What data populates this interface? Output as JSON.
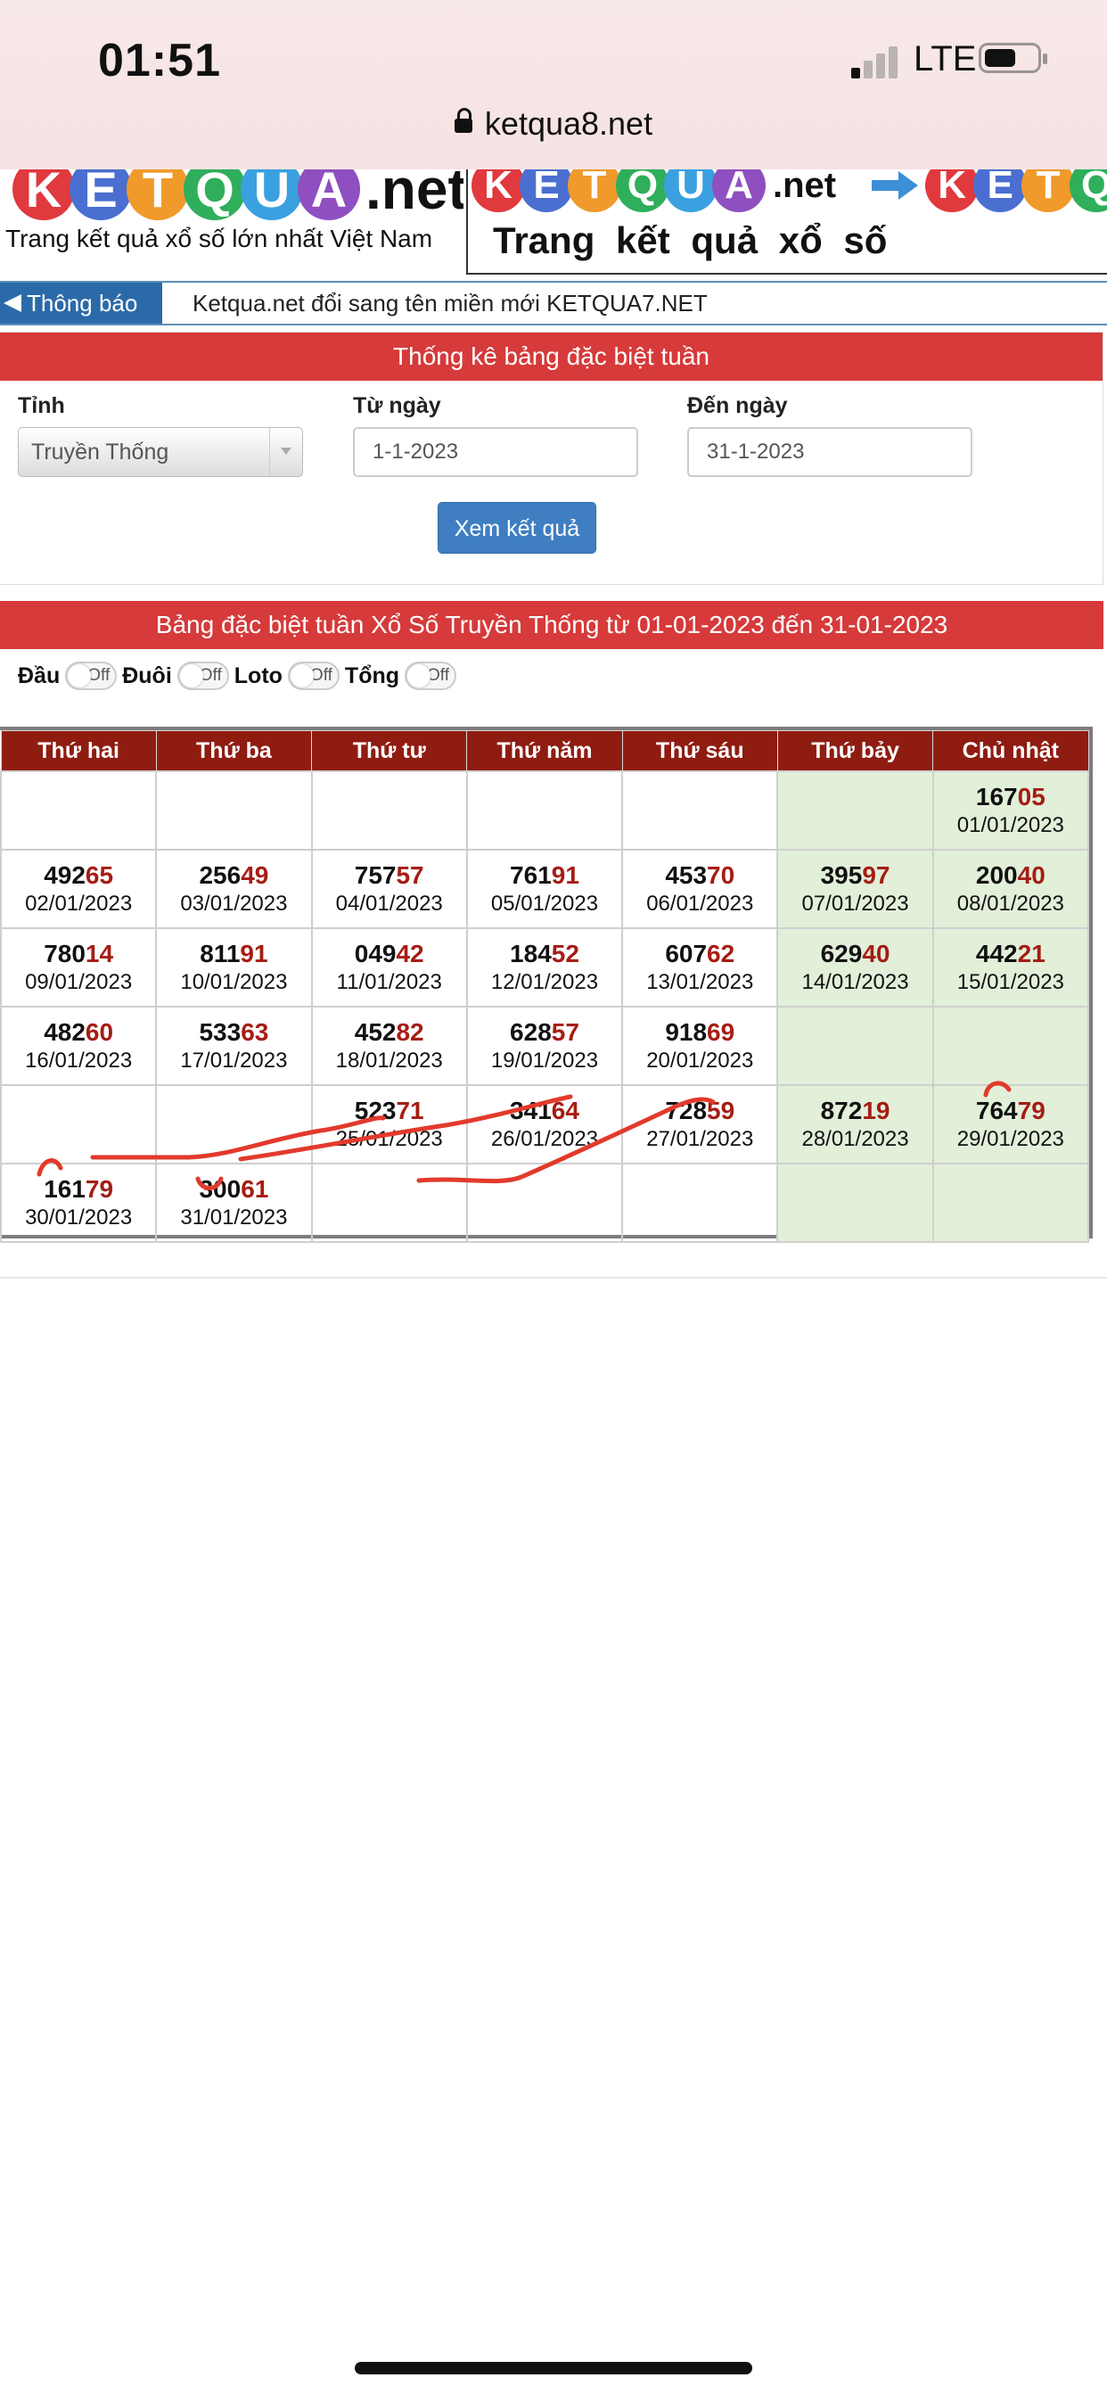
{
  "status_bar": {
    "time": "01:51",
    "network": "LTE"
  },
  "browser": {
    "url": "ketqua8.net"
  },
  "banner_left": {
    "logo_letters": [
      "K",
      "E",
      "T",
      "Q",
      "U",
      "A"
    ],
    "logo_suffix": ".net",
    "tagline": "Trang kết quả xổ số lớn nhất Việt Nam"
  },
  "banner_right": {
    "logo_letters": [
      "K",
      "E",
      "T",
      "Q",
      "U",
      "A"
    ],
    "logo_suffix": ".net",
    "logo_letters_repeat": [
      "K",
      "E",
      "T",
      "Q"
    ],
    "tagline": "Trang kết quả xổ số"
  },
  "logo_colors": [
    "#e0393e",
    "#4a6fd1",
    "#f09a2b",
    "#2fae5b",
    "#3aa0e0",
    "#8f4fc0"
  ],
  "notice": {
    "label": "Thông báo",
    "text": "Ketqua.net đổi sang tên miền mới KETQUA7.NET"
  },
  "filter": {
    "title": "Thống kê bảng đặc biệt tuần",
    "province_label": "Tỉnh",
    "province_value": "Truyền Thống",
    "from_label": "Từ ngày",
    "from_value": "1-1-2023",
    "to_label": "Đến ngày",
    "to_value": "31-1-2023",
    "submit_label": "Xem kết quả"
  },
  "results": {
    "title": "Bảng đặc biệt tuần Xổ Số Truyền Thống từ 01-01-2023 đến 31-01-2023",
    "toggles": [
      {
        "label": "Đầu",
        "state": "Off"
      },
      {
        "label": "Đuôi",
        "state": "Off"
      },
      {
        "label": "Loto",
        "state": "Off"
      },
      {
        "label": "Tổng",
        "state": "Off"
      }
    ],
    "headers": [
      "Thứ hai",
      "Thứ ba",
      "Thứ tư",
      "Thứ năm",
      "Thứ sáu",
      "Thứ bảy",
      "Chủ nhật"
    ],
    "rows": [
      [
        null,
        null,
        null,
        null,
        null,
        null,
        {
          "head": "167",
          "tail": "05",
          "date": "01/01/2023"
        }
      ],
      [
        {
          "head": "492",
          "tail": "65",
          "date": "02/01/2023"
        },
        {
          "head": "256",
          "tail": "49",
          "date": "03/01/2023"
        },
        {
          "head": "757",
          "tail": "57",
          "date": "04/01/2023"
        },
        {
          "head": "761",
          "tail": "91",
          "date": "05/01/2023"
        },
        {
          "head": "453",
          "tail": "70",
          "date": "06/01/2023"
        },
        {
          "head": "395",
          "tail": "97",
          "date": "07/01/2023"
        },
        {
          "head": "200",
          "tail": "40",
          "date": "08/01/2023"
        }
      ],
      [
        {
          "head": "780",
          "tail": "14",
          "date": "09/01/2023"
        },
        {
          "head": "811",
          "tail": "91",
          "date": "10/01/2023"
        },
        {
          "head": "049",
          "tail": "42",
          "date": "11/01/2023"
        },
        {
          "head": "184",
          "tail": "52",
          "date": "12/01/2023"
        },
        {
          "head": "607",
          "tail": "62",
          "date": "13/01/2023"
        },
        {
          "head": "629",
          "tail": "40",
          "date": "14/01/2023"
        },
        {
          "head": "442",
          "tail": "21",
          "date": "15/01/2023"
        }
      ],
      [
        {
          "head": "482",
          "tail": "60",
          "date": "16/01/2023"
        },
        {
          "head": "533",
          "tail": "63",
          "date": "17/01/2023"
        },
        {
          "head": "452",
          "tail": "82",
          "date": "18/01/2023"
        },
        {
          "head": "628",
          "tail": "57",
          "date": "19/01/2023"
        },
        {
          "head": "918",
          "tail": "69",
          "date": "20/01/2023"
        },
        null,
        null
      ],
      [
        null,
        null,
        {
          "head": "523",
          "tail": "71",
          "date": "25/01/2023"
        },
        {
          "head": "341",
          "tail": "64",
          "date": "26/01/2023"
        },
        {
          "head": "728",
          "tail": "59",
          "date": "27/01/2023"
        },
        {
          "head": "872",
          "tail": "19",
          "date": "28/01/2023"
        },
        {
          "head": "764",
          "tail": "79",
          "date": "29/01/2023"
        }
      ],
      [
        {
          "head": "161",
          "tail": "79",
          "date": "30/01/2023"
        },
        {
          "head": "300",
          "tail": "61",
          "date": "31/01/2023"
        },
        null,
        null,
        null,
        null,
        null
      ]
    ]
  }
}
